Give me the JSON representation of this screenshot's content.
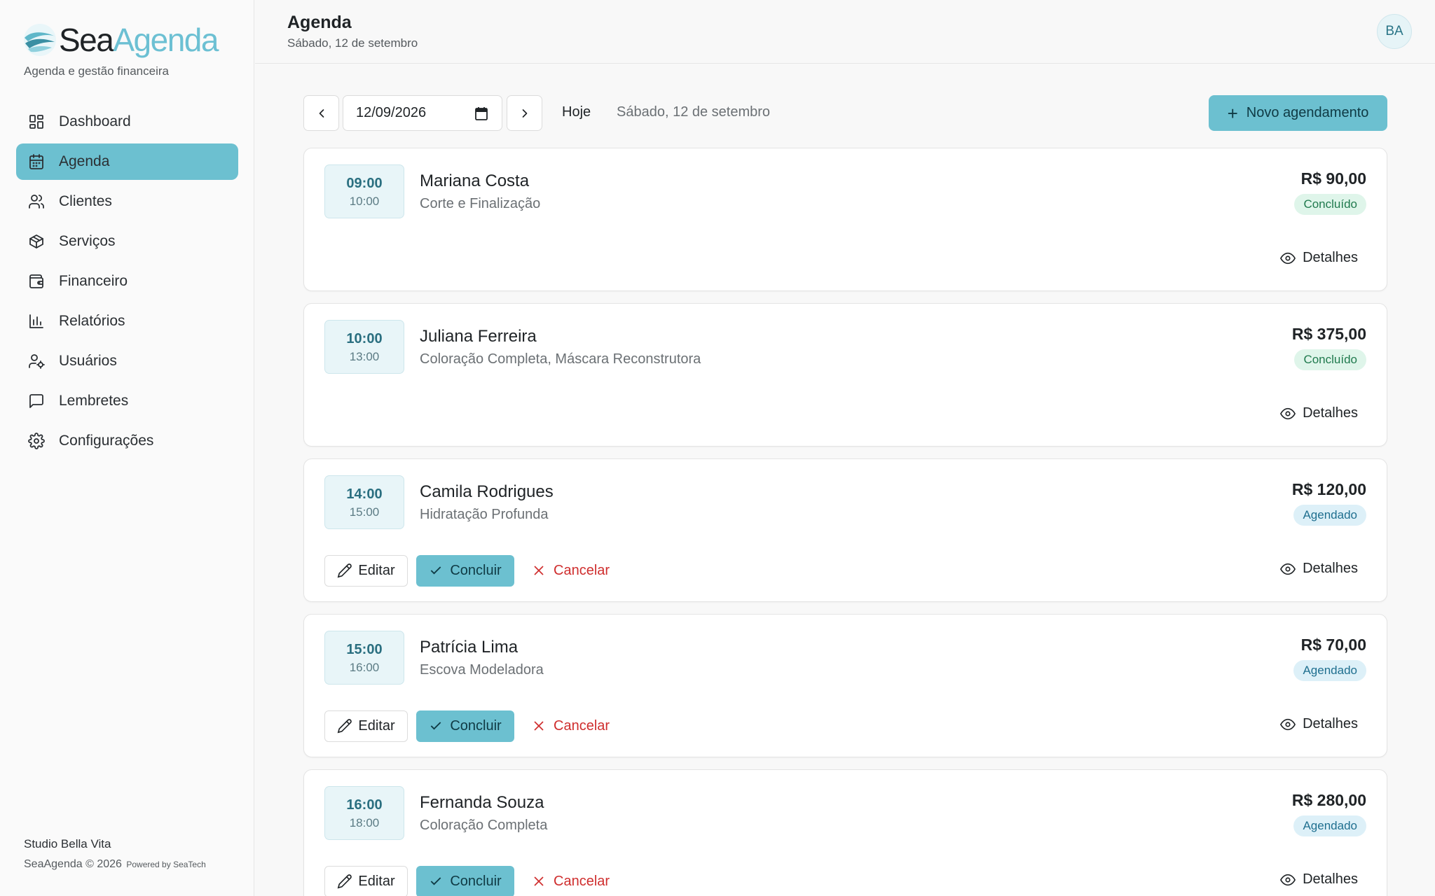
{
  "brand": {
    "name_part1": "Sea",
    "name_part2": "Agenda",
    "tagline": "Agenda e gestão financeira"
  },
  "sidebar": {
    "items": [
      {
        "label": "Dashboard",
        "icon": "dashboard-icon"
      },
      {
        "label": "Agenda",
        "icon": "calendar-icon",
        "active": true
      },
      {
        "label": "Clientes",
        "icon": "users-icon"
      },
      {
        "label": "Serviços",
        "icon": "package-icon"
      },
      {
        "label": "Financeiro",
        "icon": "wallet-icon"
      },
      {
        "label": "Relatórios",
        "icon": "bar-chart-icon"
      },
      {
        "label": "Usuários",
        "icon": "user-cog-icon"
      },
      {
        "label": "Lembretes",
        "icon": "message-icon"
      },
      {
        "label": "Configurações",
        "icon": "gear-icon"
      }
    ],
    "footer": {
      "studio": "Studio Bella Vita",
      "copyright": "SeaAgenda © 2026",
      "powered": "Powered by SeaTech"
    }
  },
  "header": {
    "title": "Agenda",
    "subtitle": "Sábado, 12 de setembro",
    "avatar_initials": "BA"
  },
  "toolbar": {
    "date_value": "12/09/2026",
    "today_label": "Hoje",
    "date_label": "Sábado, 12 de setembro",
    "new_label": "Novo agendamento"
  },
  "actions": {
    "edit": "Editar",
    "complete": "Concluir",
    "cancel": "Cancelar",
    "details": "Detalhes"
  },
  "appointments": [
    {
      "start": "09:00",
      "end": "10:00",
      "client": "Mariana Costa",
      "services": "Corte e Finalização",
      "price": "R$ 90,00",
      "status": "Concluído",
      "status_type": "done"
    },
    {
      "start": "10:00",
      "end": "13:00",
      "client": "Juliana Ferreira",
      "services": "Coloração Completa, Máscara Reconstrutora",
      "price": "R$ 375,00",
      "status": "Concluído",
      "status_type": "done"
    },
    {
      "start": "14:00",
      "end": "15:00",
      "client": "Camila Rodrigues",
      "services": "Hidratação Profunda",
      "price": "R$ 120,00",
      "status": "Agendado",
      "status_type": "scheduled"
    },
    {
      "start": "15:00",
      "end": "16:00",
      "client": "Patrícia Lima",
      "services": "Escova Modeladora",
      "price": "R$ 70,00",
      "status": "Agendado",
      "status_type": "scheduled"
    },
    {
      "start": "16:00",
      "end": "18:00",
      "client": "Fernanda Souza",
      "services": "Coloração Completa",
      "price": "R$ 280,00",
      "status": "Agendado",
      "status_type": "scheduled"
    }
  ],
  "colors": {
    "accent": "#6cc0d0",
    "done_bg": "#dff5ea",
    "scheduled_bg": "#ddf0f8",
    "danger": "#cf2e2e"
  }
}
